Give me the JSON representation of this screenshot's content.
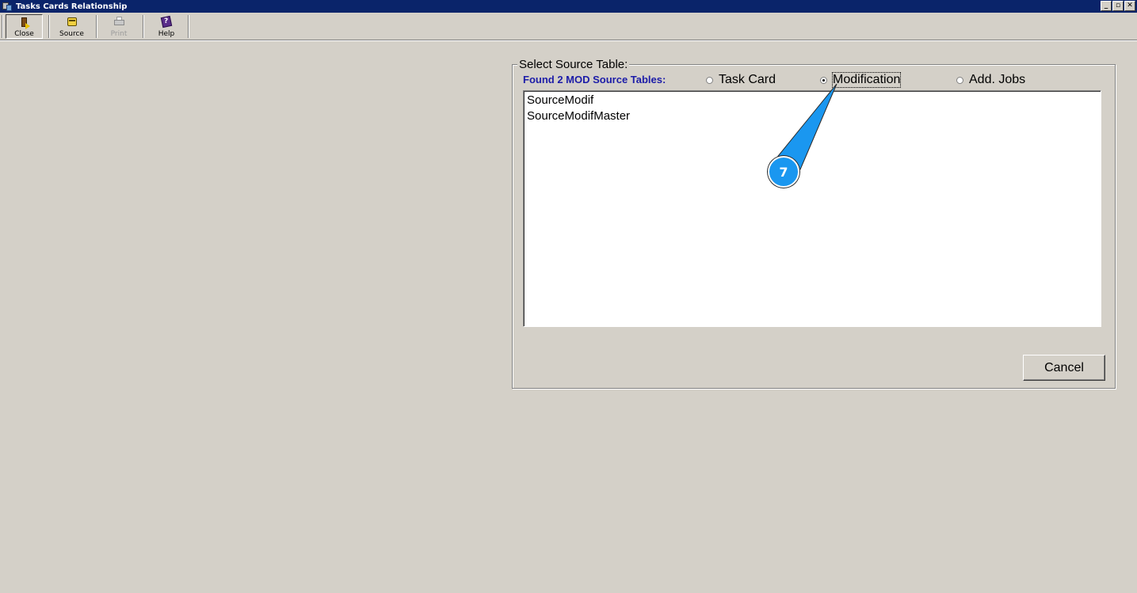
{
  "window": {
    "title": "Tasks Cards Relationship",
    "controls": [
      "minimize-icon",
      "maximize-icon",
      "close-icon"
    ],
    "minimize_glyph": "_",
    "maximize_glyph": "▫",
    "close_glyph": "✕"
  },
  "toolbar": {
    "close_label": "Close",
    "source_label": "Source",
    "print_label": "Print",
    "help_label": "Help"
  },
  "panel": {
    "group_title": "Select Source Table:",
    "found_label": "Found 2 MOD Source Tables:",
    "radios": [
      {
        "label": "Task Card",
        "checked": false
      },
      {
        "label": "Modification",
        "checked": true
      },
      {
        "label": "Add. Jobs",
        "checked": false
      }
    ],
    "list_items": [
      "SourceModif",
      "SourceModifMaster"
    ],
    "cancel_label": "Cancel"
  },
  "callout": {
    "number": "7",
    "color": "#1a97f0"
  },
  "colors": {
    "titlebar": "#0a246a",
    "face": "#d4d0c8",
    "found_label": "#1c1ca8"
  }
}
